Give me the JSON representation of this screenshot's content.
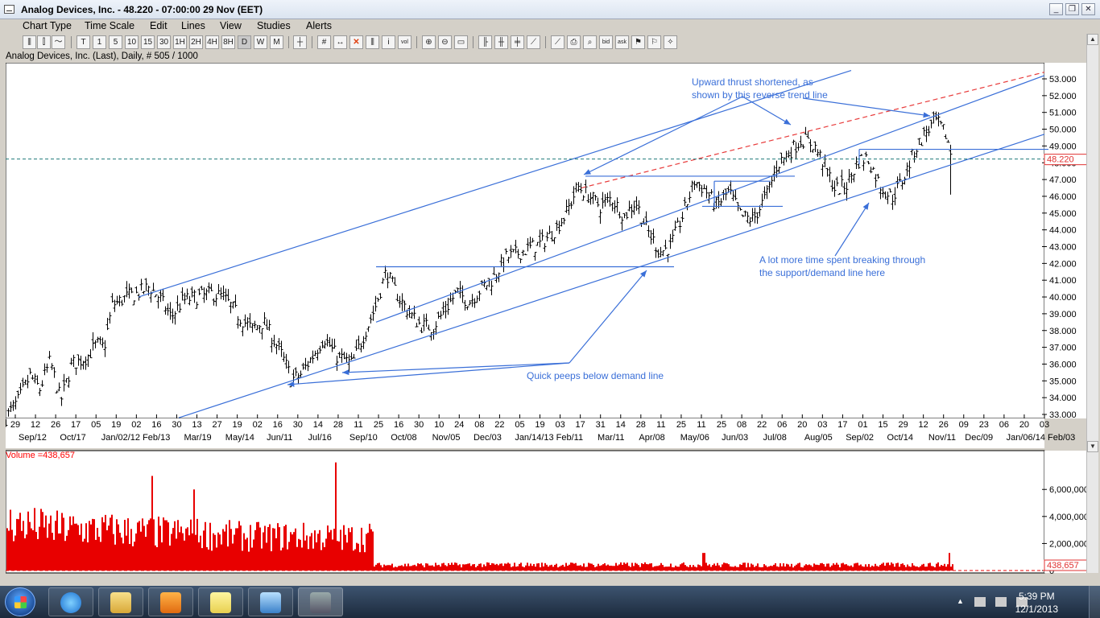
{
  "window": {
    "title": "Analog Devices, Inc.  - 48.220 - 07:00:00  29 Nov (EET)",
    "buttons": [
      "_",
      "❐",
      "✕"
    ]
  },
  "menu": [
    "Chart Type",
    "Time Scale",
    "Edit",
    "Lines",
    "View",
    "Studies",
    "Alerts"
  ],
  "toolbar": {
    "period_buttons": [
      "T",
      "1",
      "5",
      "10",
      "15",
      "30",
      "1H",
      "2H",
      "4H",
      "8H",
      "D",
      "W",
      "M"
    ],
    "selected_period": "D"
  },
  "chart_header": "Analog Devices, Inc.  (Last), Daily, # 505 / 1000",
  "price_label": "48.220",
  "volume_label": "Volume =438,657",
  "volume_value_label": "438,657",
  "annotations": {
    "upward_1": "Upward thrust shortened, as",
    "upward_2": "shown by this reverse trend line",
    "time_1": "A lot more time spent breaking through",
    "time_2": "the support/demand line here",
    "peeps": "Quick peeps below demand line"
  },
  "taskbar": {
    "time": "5:39 PM",
    "date": "12/1/2013"
  },
  "chart_data": {
    "type": "ohlc",
    "price_axis": [
      "53.000",
      "52.000",
      "51.000",
      "50.000",
      "49.000",
      "48.000",
      "47.000",
      "46.000",
      "45.000",
      "44.000",
      "43.000",
      "42.000",
      "41.000",
      "40.000",
      "39.000",
      "38.000",
      "37.000",
      "36.000",
      "35.000",
      "34.000",
      "33.000"
    ],
    "ylim": [
      33,
      53.5
    ],
    "day_ticks": [
      "29",
      "12",
      "26",
      "17",
      "05",
      "19",
      "02",
      "16",
      "30",
      "13",
      "27",
      "19",
      "02",
      "16",
      "30",
      "14",
      "28",
      "11",
      "25",
      "16",
      "30",
      "10",
      "24",
      "08",
      "22",
      "05",
      "19",
      "03",
      "17",
      "31",
      "14",
      "28",
      "11",
      "25",
      "11",
      "25",
      "08",
      "22",
      "06",
      "20",
      "03",
      "17",
      "01",
      "15",
      "29",
      "12",
      "26",
      "09",
      "23",
      "06",
      "20",
      "03"
    ],
    "month_ticks": [
      "Sep/12",
      "Oct/17",
      "Jan/02/12",
      "Feb/13",
      "Mar/19",
      "May/14",
      "Jun/11",
      "Jul/16",
      "Sep/10",
      "Oct/08",
      "Nov/05",
      "Dec/03",
      "Jan/14/13",
      "Feb/11",
      "Mar/11",
      "Apr/08",
      "May/06",
      "Jun/03",
      "Jul/08",
      "Aug/05",
      "Sep/02",
      "Oct/14",
      "Nov/11",
      "Dec/09",
      "Jan/06/14",
      "Feb/03"
    ],
    "volume_axis": [
      "6,000,000",
      "4,000,000",
      "2,000,000",
      "0"
    ],
    "price_anchors": [
      [
        0,
        32.8
      ],
      [
        15,
        33.8
      ],
      [
        30,
        35.3
      ],
      [
        42,
        34.5
      ],
      [
        55,
        36.2
      ],
      [
        68,
        33.8
      ],
      [
        82,
        36.0
      ],
      [
        100,
        36.4
      ],
      [
        113,
        37.2
      ],
      [
        122,
        37.0
      ],
      [
        132,
        39.5
      ],
      [
        150,
        40.0
      ],
      [
        163,
        40.2
      ],
      [
        178,
        40.6
      ],
      [
        190,
        40.0
      ],
      [
        205,
        38.8
      ],
      [
        220,
        39.8
      ],
      [
        238,
        40.0
      ],
      [
        255,
        40.2
      ],
      [
        270,
        40.0
      ],
      [
        290,
        38.8
      ],
      [
        305,
        38.1
      ],
      [
        320,
        38.5
      ],
      [
        340,
        36.8
      ],
      [
        355,
        35.1
      ],
      [
        365,
        35.3
      ],
      [
        380,
        36.4
      ],
      [
        395,
        37.6
      ],
      [
        410,
        36.5
      ],
      [
        430,
        36.0
      ],
      [
        445,
        37.8
      ],
      [
        458,
        39.3
      ],
      [
        472,
        41.5
      ],
      [
        485,
        40.2
      ],
      [
        500,
        39.1
      ],
      [
        515,
        38.3
      ],
      [
        530,
        38.2
      ],
      [
        545,
        39.2
      ],
      [
        560,
        40.3
      ],
      [
        575,
        39.7
      ],
      [
        590,
        40.5
      ],
      [
        605,
        41.1
      ],
      [
        620,
        42.3
      ],
      [
        635,
        42.6
      ],
      [
        650,
        42.9
      ],
      [
        665,
        43.2
      ],
      [
        680,
        43.9
      ],
      [
        695,
        44.9
      ],
      [
        710,
        46.6
      ],
      [
        722,
        46.1
      ],
      [
        738,
        45.4
      ],
      [
        752,
        45.9
      ],
      [
        768,
        44.8
      ],
      [
        782,
        45.7
      ],
      [
        795,
        44.1
      ],
      [
        812,
        42.7
      ],
      [
        825,
        43.0
      ],
      [
        840,
        44.8
      ],
      [
        855,
        46.9
      ],
      [
        868,
        46.4
      ],
      [
        882,
        45.4
      ],
      [
        898,
        46.3
      ],
      [
        913,
        44.8
      ],
      [
        928,
        44.6
      ],
      [
        945,
        46.1
      ],
      [
        958,
        47.9
      ],
      [
        972,
        48.6
      ],
      [
        988,
        49.4
      ],
      [
        1003,
        49.1
      ],
      [
        1015,
        48.0
      ],
      [
        1030,
        46.4
      ],
      [
        1045,
        46.7
      ],
      [
        1058,
        48.1
      ],
      [
        1070,
        48.3
      ],
      [
        1085,
        46.7
      ],
      [
        1100,
        45.9
      ],
      [
        1115,
        47.1
      ],
      [
        1128,
        48.7
      ],
      [
        1142,
        49.8
      ],
      [
        1155,
        50.5
      ],
      [
        1168,
        49.6
      ],
      [
        1175,
        48.2
      ]
    ],
    "volume_profile": [
      [
        0,
        3500000
      ],
      [
        60,
        3100000
      ],
      [
        120,
        3000000
      ],
      [
        180,
        2800000
      ],
      [
        240,
        2700000
      ],
      [
        300,
        2500000
      ],
      [
        360,
        2500000
      ],
      [
        420,
        2400000
      ],
      [
        455,
        2500000
      ],
      [
        456,
        400000
      ],
      [
        600,
        420000
      ],
      [
        800,
        420000
      ],
      [
        1000,
        400000
      ],
      [
        1170,
        420000
      ]
    ],
    "volume_spikes": [
      [
        180,
        7000000
      ],
      [
        232,
        6000000
      ],
      [
        408,
        8000000
      ],
      [
        865,
        1300000
      ],
      [
        1170,
        1300000
      ]
    ],
    "trendlines": [
      {
        "from": [
          165,
          40.0
        ],
        "to": [
          1050,
          53.5
        ]
      },
      {
        "from": [
          215,
          32.8
        ],
        "to": [
          1290,
          49.7
        ]
      },
      {
        "from": [
          460,
          38.5
        ],
        "to": [
          1290,
          53.2
        ]
      },
      {
        "from": [
          715,
          46.5
        ],
        "to": [
          1290,
          53.4
        ]
      }
    ],
    "hlines": [
      {
        "from": [
          460,
          41.8
        ],
        "to": [
          830,
          41.8
        ]
      },
      {
        "from": [
          720,
          47.2
        ],
        "to": [
          980,
          47.2
        ]
      },
      {
        "from": [
          865,
          45.4
        ],
        "to": [
          965,
          45.4
        ]
      },
      {
        "from": [
          880,
          46.9
        ],
        "to": [
          950,
          46.9
        ]
      },
      {
        "from": [
          1060,
          48.8
        ],
        "to": [
          1295,
          48.8
        ]
      }
    ],
    "current_price": 48.22
  }
}
